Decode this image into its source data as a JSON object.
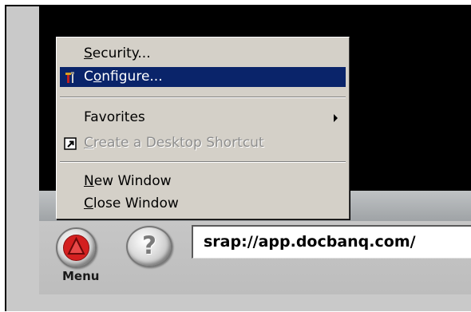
{
  "menu": {
    "items": [
      {
        "pre": "",
        "accel": "S",
        "post": "ecurity...",
        "state": "normal"
      },
      {
        "pre": "",
        "accel": "o",
        "post": "nfigure...",
        "state": "selected",
        "icon": "configure-tools-icon",
        "lead": "C"
      },
      {
        "label": "Favorites",
        "state": "normal",
        "submenu": true
      },
      {
        "pre": "",
        "accel": "C",
        "post": "reate a Desktop Shortcut",
        "state": "disabled",
        "icon": "shortcut-arrow-icon"
      },
      {
        "pre": "",
        "accel": "N",
        "post": "ew Window",
        "state": "normal"
      },
      {
        "pre": "",
        "accel": "C",
        "post": "lose Window",
        "state": "normal"
      }
    ]
  },
  "toolbar": {
    "menu_label": "Menu",
    "help_glyph": "?",
    "address_value": "srap://app.docbanq.com/"
  },
  "icons": {
    "menu_button": "red-up-triangle-icon",
    "help_button": "question-mark-icon",
    "configure": "configure-tools-icon",
    "shortcut": "shortcut-arrow-icon",
    "submenu": "submenu-arrow-icon"
  },
  "colors": {
    "selection": "#0a246a",
    "menu_bg": "#d4d0c8",
    "menu_button_triangle": "#d42020",
    "dark_area": "#000000"
  }
}
